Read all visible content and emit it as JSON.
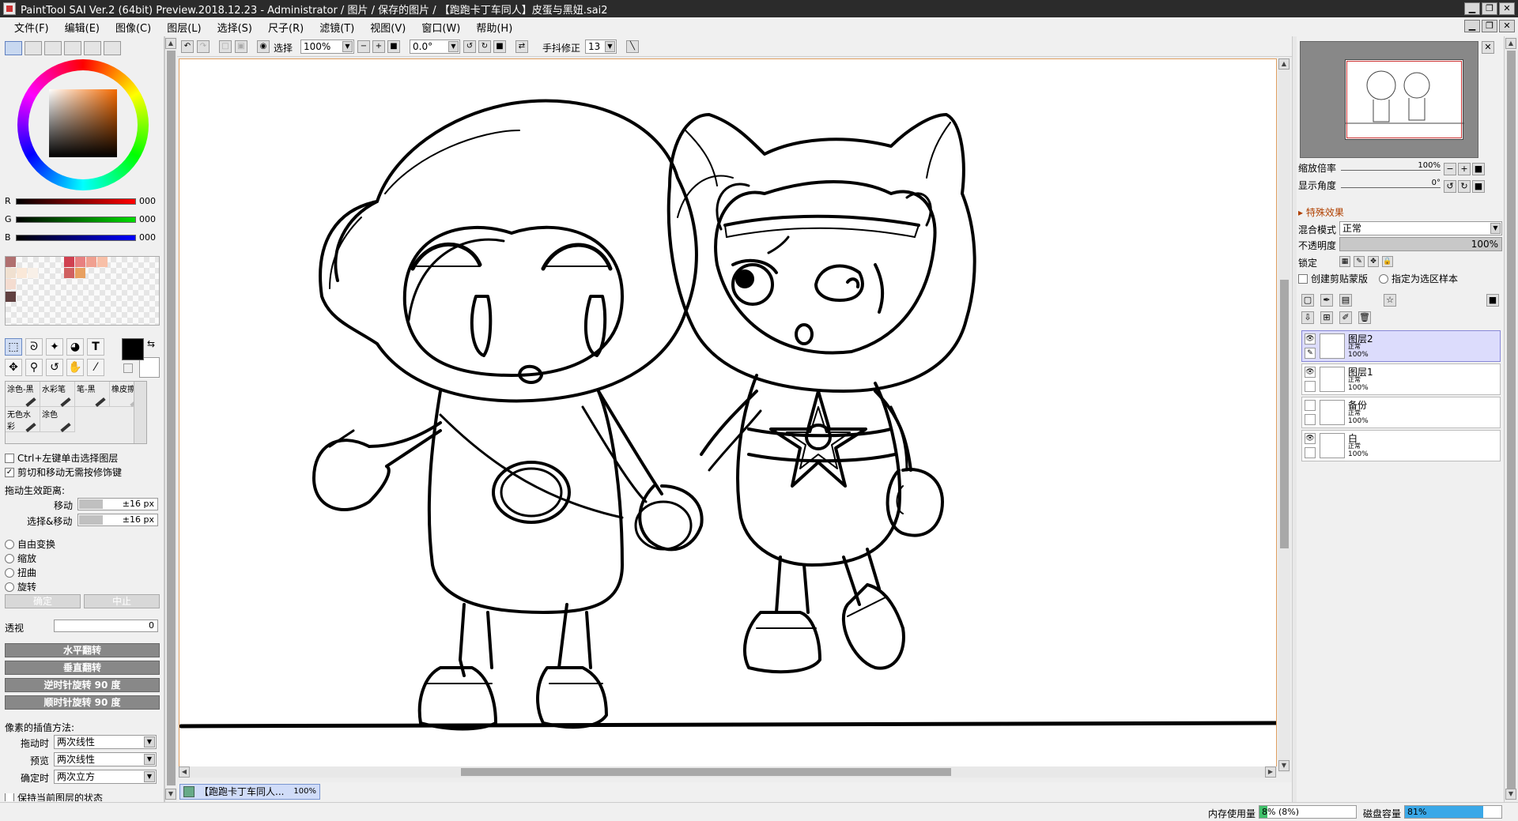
{
  "window": {
    "title": "PaintTool SAI Ver.2 (64bit) Preview.2018.12.23 - Administrator / 图片 / 保存的图片 / 【跑跑卡丁车同人】皮蛋与黑妞.sai2",
    "min": "▁",
    "max": "❐",
    "close": "✕"
  },
  "menu": [
    "文件(F)",
    "编辑(E)",
    "图像(C)",
    "图层(L)",
    "选择(S)",
    "尺子(R)",
    "滤镜(T)",
    "视图(V)",
    "窗口(W)",
    "帮助(H)"
  ],
  "color": {
    "r_label": "R",
    "r_value": "000",
    "g_label": "G",
    "g_value": "000",
    "b_label": "B",
    "b_value": "000",
    "foreground": "#000000",
    "background": "#ffffff"
  },
  "swatches": [
    "#b07070",
    "#d04050",
    "#e88080",
    "#f0a090",
    "#f8c0a8",
    "#d06060",
    "#e8a060",
    "#f0e0d0",
    "#fae8d8",
    "#f8f0e8",
    "#604040",
    "#f4dcd0"
  ],
  "tools": {
    "text_icon": "T",
    "brushes": [
      "涂色-黑",
      "水彩笔",
      "笔-黑",
      "橡皮擦",
      "无色水彩",
      "涂色"
    ]
  },
  "options": {
    "ctrl_select": "Ctrl+左键单击选择图层",
    "cut_move": "剪切和移动无需按修饰键",
    "drag_distance": "拖动生效距离:",
    "move_label": "移动",
    "move_value": "±16 px",
    "select_move_label": "选择&移动",
    "select_move_value": "±16 px",
    "free_transform": "自由变换",
    "scale": "缩放",
    "distort": "扭曲",
    "rotate": "旋转",
    "ok": "确定",
    "abort": "中止",
    "perspective_label": "透视",
    "perspective_value": "0",
    "flip_h": "水平翻转",
    "flip_v": "垂直翻转",
    "rot_ccw": "逆时针旋转 90 度",
    "rot_cw": "顺时针旋转 90 度",
    "interp_title": "像素的插值方法:",
    "drag_label": "拖动时",
    "drag_val": "两次线性",
    "preview_label": "预览",
    "preview_val": "两次线性",
    "confirm_label": "确定时",
    "confirm_val": "两次立方",
    "keep_label": "保持当前图层的状态"
  },
  "toolbar": {
    "select_label": "选择",
    "zoom": "100%",
    "angle": "0.0°",
    "stabilizer_label": "手抖修正",
    "stabilizer_value": "13"
  },
  "doc_tab": {
    "name": "【跑跑卡丁车同人...",
    "zoom": "100%"
  },
  "navigator": {
    "zoom_label": "缩放倍率",
    "zoom_value": "100%",
    "angle_label": "显示角度",
    "angle_value": "0°"
  },
  "layer_props": {
    "section": "▸ 特殊效果",
    "blend_label": "混合模式",
    "blend_value": "正常",
    "opacity_label": "不透明度",
    "opacity_value": "100%",
    "lock_label": "锁定",
    "clip_label": "创建剪贴蒙版",
    "sample_label": "指定为选区样本"
  },
  "layers": [
    {
      "name": "图层2",
      "mode": "正常",
      "opacity": "100%",
      "visible": true,
      "selected": true
    },
    {
      "name": "图层1",
      "mode": "正常",
      "opacity": "100%",
      "visible": true,
      "selected": false
    },
    {
      "name": "备份",
      "mode": "正常",
      "opacity": "100%",
      "visible": false,
      "selected": false
    },
    {
      "name": "白",
      "mode": "正常",
      "opacity": "100%",
      "visible": true,
      "selected": false
    }
  ],
  "status": {
    "mem_label": "内存使用量",
    "mem_value": "8% (8%)",
    "mem_fraction": 0.08,
    "disk_label": "磁盘容量",
    "disk_value": "81%",
    "disk_fraction": 0.81,
    "accent": "#3aa8e8"
  }
}
